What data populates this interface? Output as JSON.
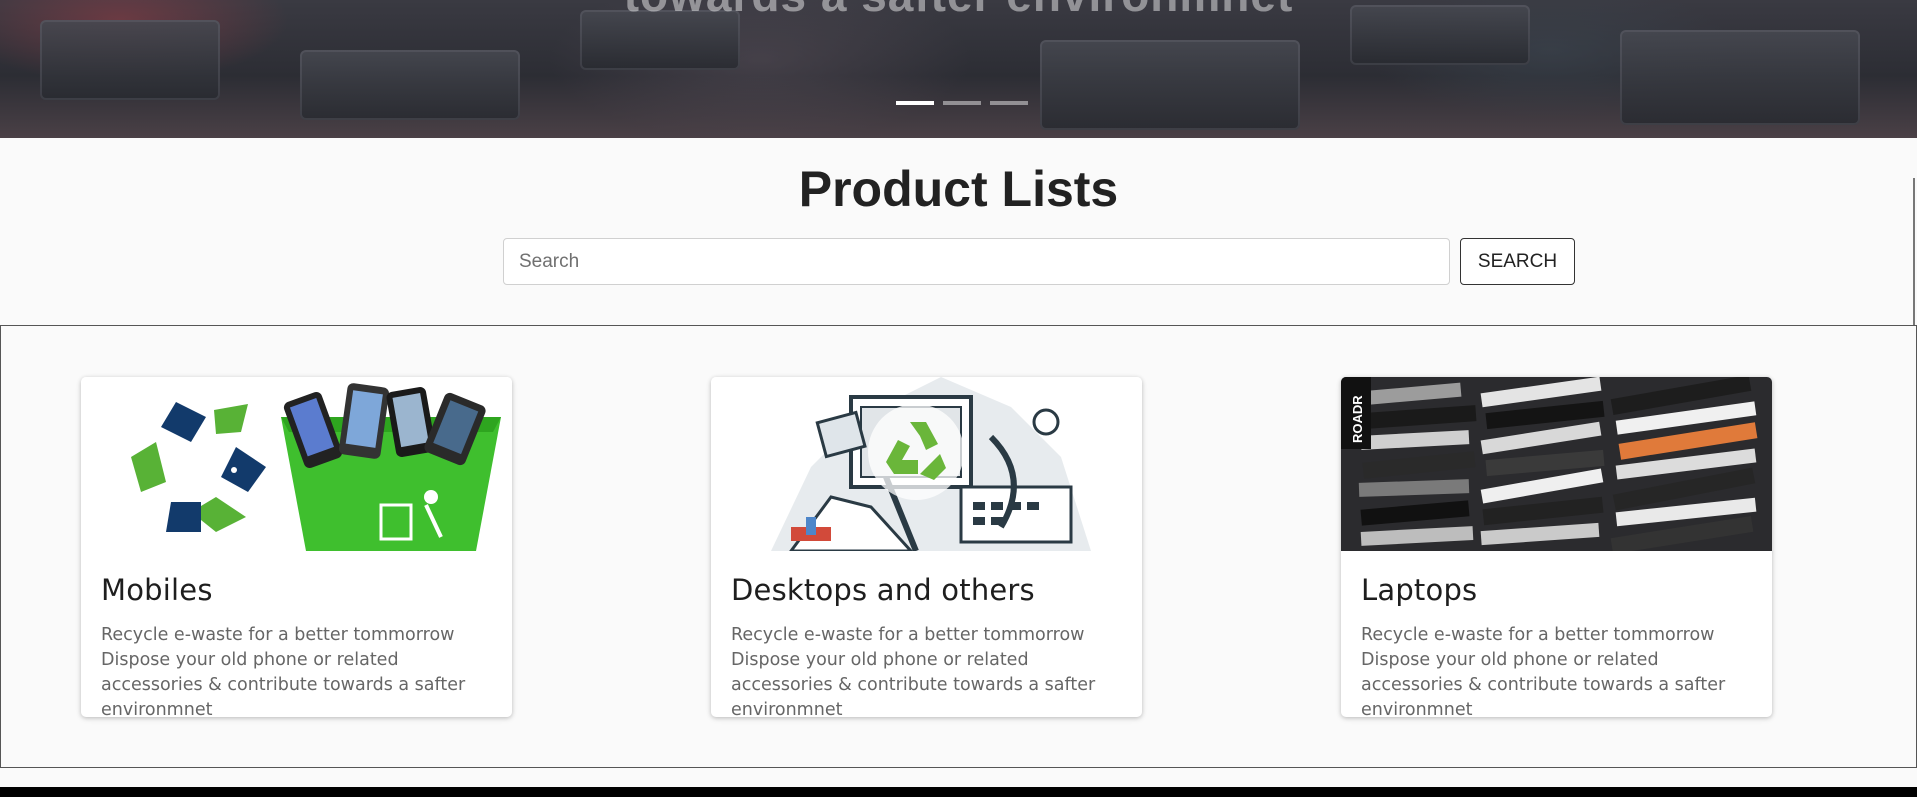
{
  "hero": {
    "caption": "towards a safter environmnet",
    "slides": 3,
    "active_slide": 1
  },
  "page_title": "Product Lists",
  "search": {
    "placeholder": "Search",
    "value": "",
    "button_label": "SEARCH"
  },
  "products": [
    {
      "title": "Mobiles",
      "description": "Recycle e-waste for a better tommorrow Dispose your old phone or related accessories & contribute towards a safter environmnet",
      "image_icon": "recycle-bin-phones-icon"
    },
    {
      "title": "Desktops and others",
      "description": "Recycle e-waste for a better tommorrow Dispose your old phone or related accessories & contribute towards a safter environmnet",
      "image_icon": "e-waste-pile-icon"
    },
    {
      "title": "Laptops",
      "description": "Recycle e-waste for a better tommorrow Dispose your old phone or related accessories & contribute towards a safter environmnet",
      "image_icon": "laptop-stack-icon",
      "image_watermark": "ROADR"
    }
  ],
  "colors": {
    "recycle_green": "#58b236",
    "recycle_navy": "#123a6b",
    "bin_green": "#3fbf2e"
  }
}
